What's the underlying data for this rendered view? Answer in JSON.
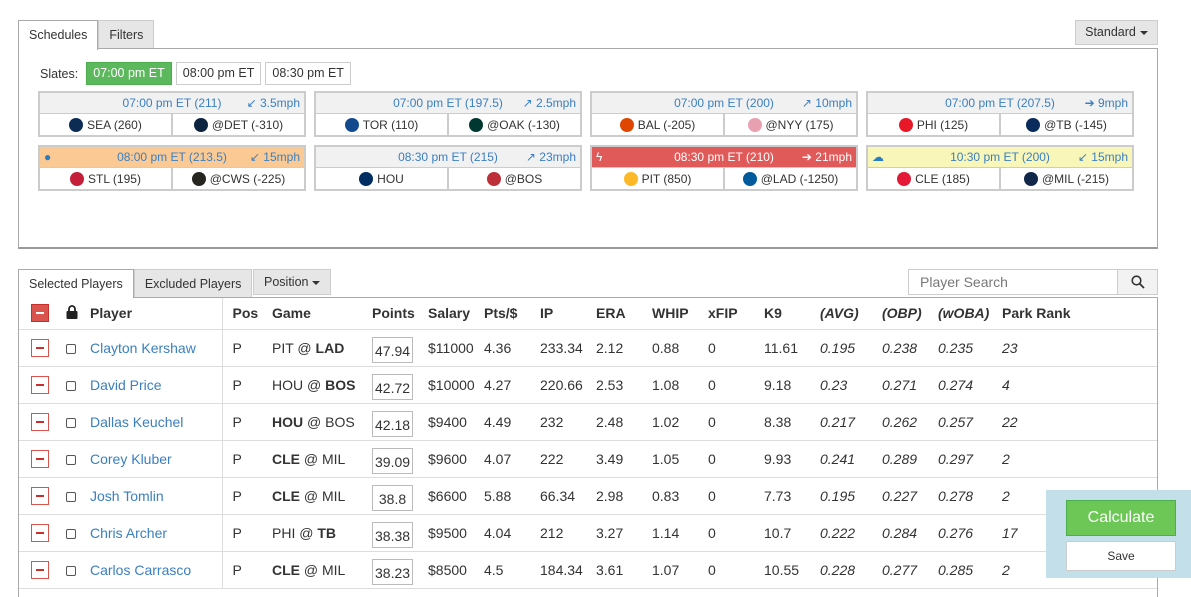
{
  "top_tabs": [
    {
      "label": "Schedules",
      "active": true
    },
    {
      "label": "Filters",
      "active": false
    }
  ],
  "standard_dropdown": {
    "label": "Standard"
  },
  "slates": {
    "label": "Slates:",
    "options": [
      {
        "label": "07:00 pm ET",
        "active": true
      },
      {
        "label": "08:00 pm ET",
        "active": false
      },
      {
        "label": "08:30 pm ET",
        "active": false
      }
    ]
  },
  "games": [
    {
      "time": "07:00 pm ET (211)",
      "wind": "3.5mph",
      "wind_icon": "arrow-down-left-icon",
      "weather_icon": "",
      "highlight": "none",
      "home": {
        "label": "SEA (260)",
        "logo": "mariners-logo",
        "color": "#0c2c56"
      },
      "away": {
        "label": "@DET (-310)",
        "logo": "tigers-logo",
        "color": "#0c2340"
      }
    },
    {
      "time": "07:00 pm ET (197.5)",
      "wind": "2.5mph",
      "wind_icon": "arrow-up-right-icon",
      "weather_icon": "",
      "highlight": "none",
      "home": {
        "label": "TOR (110)",
        "logo": "bluejays-logo",
        "color": "#134a8e"
      },
      "away": {
        "label": "@OAK (-130)",
        "logo": "athletics-logo",
        "color": "#003831"
      }
    },
    {
      "time": "07:00 pm ET (200)",
      "wind": "10mph",
      "wind_icon": "arrow-up-right-icon",
      "weather_icon": "",
      "highlight": "none",
      "home": {
        "label": "BAL (-205)",
        "logo": "orioles-logo",
        "color": "#df4601"
      },
      "away": {
        "label": "@NYY (175)",
        "logo": "yankees-logo",
        "color": "#e8a0b0"
      }
    },
    {
      "time": "07:00 pm ET (207.5)",
      "wind": "9mph",
      "wind_icon": "arrow-right-icon",
      "weather_icon": "",
      "highlight": "none",
      "home": {
        "label": "PHI (125)",
        "logo": "phillies-logo",
        "color": "#e81828"
      },
      "away": {
        "label": "@TB (-145)",
        "logo": "rays-logo",
        "color": "#092c5c"
      }
    },
    {
      "time": "08:00 pm ET (213.5)",
      "wind": "15mph",
      "wind_icon": "arrow-down-left-icon",
      "weather_icon": "rain-drop-icon",
      "highlight": "orange",
      "home": {
        "label": "STL (195)",
        "logo": "cardinals-logo",
        "color": "#c41e3a"
      },
      "away": {
        "label": "@CWS (-225)",
        "logo": "whitesox-logo",
        "color": "#27251f"
      }
    },
    {
      "time": "08:30 pm ET (215)",
      "wind": "23mph",
      "wind_icon": "arrow-up-right-icon",
      "weather_icon": "",
      "highlight": "none",
      "home": {
        "label": "HOU",
        "logo": "astros-logo",
        "color": "#002d62"
      },
      "away": {
        "label": "@BOS",
        "logo": "redsox-logo",
        "color": "#bd3039"
      }
    },
    {
      "time": "08:30 pm ET (210)",
      "wind": "21mph",
      "wind_icon": "arrow-right-icon",
      "weather_icon": "lightning-icon",
      "highlight": "red",
      "home": {
        "label": "PIT (850)",
        "logo": "pirates-logo",
        "color": "#fdb827"
      },
      "away": {
        "label": "@LAD (-1250)",
        "logo": "dodgers-logo",
        "color": "#005a9c"
      }
    },
    {
      "time": "10:30 pm ET (200)",
      "wind": "15mph",
      "wind_icon": "arrow-down-left-icon",
      "weather_icon": "cloud-icon",
      "highlight": "yellow",
      "home": {
        "label": "CLE (185)",
        "logo": "indians-logo",
        "color": "#e31937"
      },
      "away": {
        "label": "@MIL (-215)",
        "logo": "brewers-logo",
        "color": "#12284b"
      }
    }
  ],
  "lower_tabs": [
    {
      "label": "Selected Players",
      "active": true
    },
    {
      "label": "Excluded Players",
      "active": false
    }
  ],
  "position_dropdown": {
    "label": "Position"
  },
  "search": {
    "placeholder": "Player Search",
    "value": ""
  },
  "table": {
    "columns": [
      "Player",
      "Pos",
      "Game",
      "Points",
      "Salary",
      "Pts/$",
      "IP",
      "ERA",
      "WHIP",
      "xFIP",
      "K9",
      "(AVG)",
      "(OBP)",
      "(wOBA)",
      "Park Rank"
    ],
    "rows": [
      {
        "player": "Clayton Kershaw",
        "pos": "P",
        "game_home": "PIT",
        "game_away": "LAD",
        "bold": "away",
        "points": "47.94",
        "salary": "$11000",
        "pts_per": "4.36",
        "ip": "233.34",
        "era": "2.12",
        "whip": "0.88",
        "xfip": "0",
        "k9": "11.61",
        "avg": "0.195",
        "obp": "0.238",
        "woba": "0.235",
        "park_rank": "23"
      },
      {
        "player": "David Price",
        "pos": "P",
        "game_home": "HOU",
        "game_away": "BOS",
        "bold": "away",
        "points": "42.72",
        "salary": "$10000",
        "pts_per": "4.27",
        "ip": "220.66",
        "era": "2.53",
        "whip": "1.08",
        "xfip": "0",
        "k9": "9.18",
        "avg": "0.23",
        "obp": "0.271",
        "woba": "0.274",
        "park_rank": "4"
      },
      {
        "player": "Dallas Keuchel",
        "pos": "P",
        "game_home": "HOU",
        "game_away": "BOS",
        "bold": "home",
        "points": "42.18",
        "salary": "$9400",
        "pts_per": "4.49",
        "ip": "232",
        "era": "2.48",
        "whip": "1.02",
        "xfip": "0",
        "k9": "8.38",
        "avg": "0.217",
        "obp": "0.262",
        "woba": "0.257",
        "park_rank": "22"
      },
      {
        "player": "Corey Kluber",
        "pos": "P",
        "game_home": "CLE",
        "game_away": "MIL",
        "bold": "home",
        "points": "39.09",
        "salary": "$9600",
        "pts_per": "4.07",
        "ip": "222",
        "era": "3.49",
        "whip": "1.05",
        "xfip": "0",
        "k9": "9.93",
        "avg": "0.241",
        "obp": "0.289",
        "woba": "0.297",
        "park_rank": "2"
      },
      {
        "player": "Josh Tomlin",
        "pos": "P",
        "game_home": "CLE",
        "game_away": "MIL",
        "bold": "home",
        "points": "38.8",
        "salary": "$6600",
        "pts_per": "5.88",
        "ip": "66.34",
        "era": "2.98",
        "whip": "0.83",
        "xfip": "0",
        "k9": "7.73",
        "avg": "0.195",
        "obp": "0.227",
        "woba": "0.278",
        "park_rank": "2"
      },
      {
        "player": "Chris Archer",
        "pos": "P",
        "game_home": "PHI",
        "game_away": "TB",
        "bold": "away",
        "points": "38.38",
        "salary": "$9500",
        "pts_per": "4.04",
        "ip": "212",
        "era": "3.27",
        "whip": "1.14",
        "xfip": "0",
        "k9": "10.7",
        "avg": "0.222",
        "obp": "0.284",
        "woba": "0.276",
        "park_rank": "17"
      },
      {
        "player": "Carlos Carrasco",
        "pos": "P",
        "game_home": "CLE",
        "game_away": "MIL",
        "bold": "home",
        "points": "38.23",
        "salary": "$8500",
        "pts_per": "4.5",
        "ip": "184.34",
        "era": "3.61",
        "whip": "1.07",
        "xfip": "0",
        "k9": "10.55",
        "avg": "0.228",
        "obp": "0.277",
        "woba": "0.285",
        "park_rank": "2"
      }
    ]
  },
  "actions": {
    "calculate_label": "Calculate",
    "save_label": "Save"
  },
  "colors": {
    "accent_green": "#5cb85c",
    "link_blue": "#3a7fc1",
    "danger_red": "#d9534f",
    "highlight_orange": "#fbca94",
    "highlight_red": "#e05a5a",
    "highlight_yellow": "#f8f7b9",
    "action_panel": "#c3e0ea"
  }
}
